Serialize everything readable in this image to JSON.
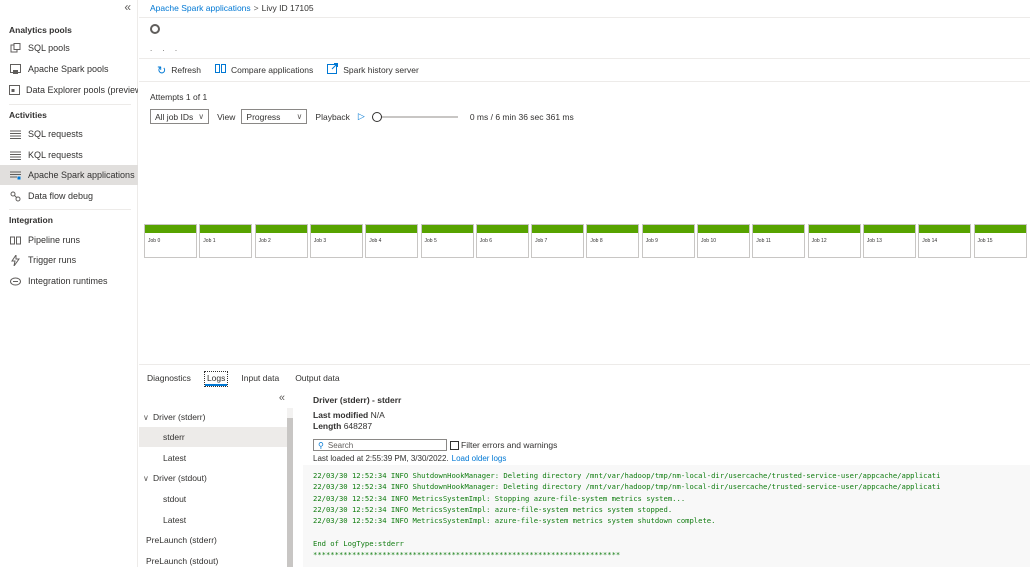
{
  "nav": {
    "collapse_glyph": "«",
    "sections": [
      {
        "heading": "Analytics pools",
        "items": [
          {
            "label": "SQL pools",
            "icon": "sql-pool-icon"
          },
          {
            "label": "Apache Spark pools",
            "icon": "spark-pool-icon"
          },
          {
            "label": "Data Explorer pools (preview)",
            "icon": "data-explorer-icon"
          }
        ]
      },
      {
        "heading": "Activities",
        "items": [
          {
            "label": "SQL requests",
            "icon": "list-icon"
          },
          {
            "label": "KQL requests",
            "icon": "list-icon"
          },
          {
            "label": "Apache Spark applications",
            "icon": "spark-app-icon",
            "selected": true
          },
          {
            "label": "Data flow debug",
            "icon": "dataflow-icon"
          }
        ]
      },
      {
        "heading": "Integration",
        "items": [
          {
            "label": "Pipeline runs",
            "icon": "pipeline-icon"
          },
          {
            "label": "Trigger runs",
            "icon": "trigger-icon"
          },
          {
            "label": "Integration runtimes",
            "icon": "runtime-icon"
          }
        ]
      }
    ]
  },
  "breadcrumb": {
    "root": "Apache Spark applications",
    "separator": ">",
    "current": "Livy ID 17105"
  },
  "subtitle_dots": ". . .",
  "toolbar": {
    "refresh": "Refresh",
    "compare": "Compare applications",
    "history": "Spark history server"
  },
  "attempts": "Attempts 1 of 1",
  "filter": {
    "job_ids": "All job IDs",
    "view_label": "View",
    "view_value": "Progress",
    "playback_label": "Playback",
    "playback_time": "0 ms / 6 min 36 sec 361 ms",
    "playback_progress": 0
  },
  "jobs": [
    "Job 0",
    "Job 1",
    "Job 2",
    "Job 3",
    "Job 4",
    "Job 5",
    "Job 6",
    "Job 7",
    "Job 8",
    "Job 9",
    "Job 10",
    "Job 11",
    "Job 12",
    "Job 13",
    "Job 14",
    "Job 15"
  ],
  "colors": {
    "accent": "#0078d4",
    "job_success": "#57a300",
    "log_text": "#107c10"
  },
  "tabs": [
    "Diagnostics",
    "Logs",
    "Input data",
    "Output data"
  ],
  "active_tab": "Logs",
  "log_tree": {
    "collapse_glyph": "«",
    "items": [
      {
        "label": "Driver (stderr)",
        "expandable": true
      },
      {
        "label": "stderr",
        "child": true,
        "selected": true
      },
      {
        "label": "Latest",
        "child": true
      },
      {
        "label": "Driver (stdout)",
        "expandable": true
      },
      {
        "label": "stdout",
        "child": true
      },
      {
        "label": "Latest",
        "child": true
      },
      {
        "label": "PreLaunch (stderr)"
      },
      {
        "label": "PreLaunch (stdout)"
      }
    ]
  },
  "log": {
    "title": "Driver (stderr) - stderr",
    "modified_label": "Last modified",
    "modified_value": "N/A",
    "length_label": "Length",
    "length_value": "648287",
    "search_placeholder": "Search",
    "filter_label": "Filter errors and warnings",
    "loaded_text": "Last loaded at 2:55:39 PM, 3/30/2022.",
    "load_older": "Load older logs",
    "lines": [
      "22/03/30 12:52:34 INFO ShutdownHookManager: Deleting directory /mnt/var/hadoop/tmp/nm-local-dir/usercache/trusted-service-user/appcache/applicati",
      "22/03/30 12:52:34 INFO ShutdownHookManager: Deleting directory /mnt/var/hadoop/tmp/nm-local-dir/usercache/trusted-service-user/appcache/applicati",
      "22/03/30 12:52:34 INFO MetricsSystemImpl: Stopping azure-file-system metrics system...",
      "22/03/30 12:52:34 INFO MetricsSystemImpl: azure-file-system metrics system stopped.",
      "22/03/30 12:52:34 INFO MetricsSystemImpl: azure-file-system metrics system shutdown complete.",
      "",
      "End of LogType:stderr",
      "***********************************************************************"
    ]
  }
}
